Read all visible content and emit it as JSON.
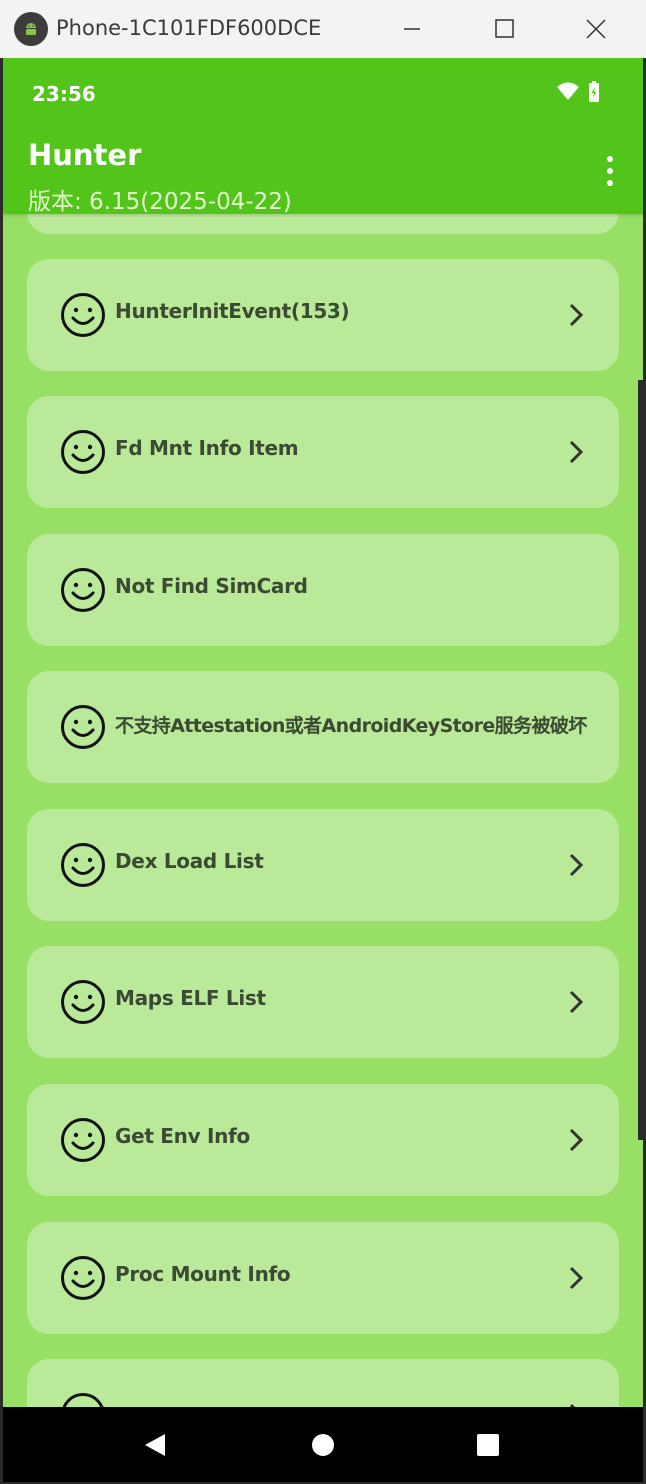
{
  "window": {
    "title": "Phone-1C101FDF600DCE"
  },
  "status_bar": {
    "time": "23:56",
    "icons": [
      "wifi-icon",
      "battery-charging-icon"
    ]
  },
  "app_bar": {
    "title": "Hunter",
    "subtitle": "版本: 6.15(2025-04-22)"
  },
  "items": [
    {
      "label": "HunterInitEvent(153)",
      "has_chevron": true
    },
    {
      "label": "Fd Mnt Info Item",
      "has_chevron": true
    },
    {
      "label": "Not Find SimCard",
      "has_chevron": false
    },
    {
      "label": "不支持Attestation或者AndroidKeyStore服务被破坏",
      "has_chevron": false
    },
    {
      "label": "Dex Load List",
      "has_chevron": true
    },
    {
      "label": "Maps ELF List",
      "has_chevron": true
    },
    {
      "label": "Get Env Info",
      "has_chevron": true
    },
    {
      "label": "Proc Mount Info",
      "has_chevron": true
    }
  ],
  "colors": {
    "app_bar": "#52c41a",
    "background": "#98df66",
    "card": "#bbe99a",
    "text": "#3b4a33"
  }
}
